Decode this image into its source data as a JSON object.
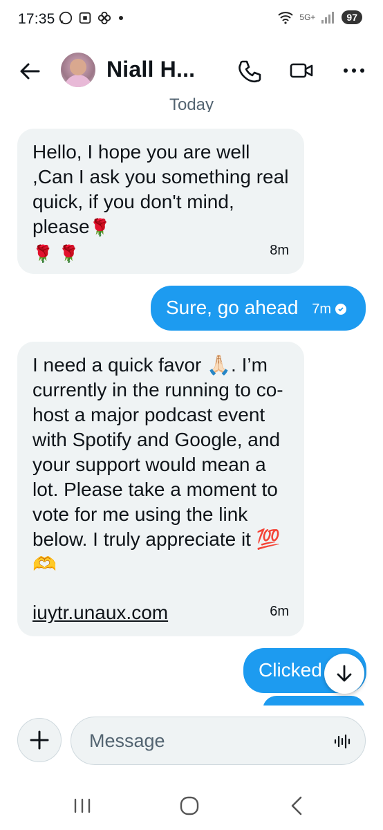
{
  "status_bar": {
    "time": "17:35",
    "battery": "97",
    "network": "5G+"
  },
  "header": {
    "contact_name": "Niall H...",
    "accent": "#0f1419"
  },
  "date_divider": "Today",
  "messages": [
    {
      "direction": "incoming",
      "text": "Hello, I hope you are well ,Can I ask you something real quick, if you don't mind, please",
      "time": "8m"
    },
    {
      "direction": "outgoing",
      "text": "Sure, go ahead",
      "time": "7m"
    },
    {
      "direction": "incoming",
      "text": "I need a quick favor 🙏🏻. I’m currently in the running to co-host a major podcast event with Spotify and Google, and your support would mean a lot. Please take a moment to vote for me using the link below. I truly appreciate it 💯🫶",
      "link": "iuytr.unaux.com",
      "time": "6m"
    },
    {
      "direction": "outgoing",
      "text": "Clicked"
    }
  ],
  "composer": {
    "placeholder": "Message"
  },
  "colors": {
    "outgoing_bubble": "#1d9bf0",
    "incoming_bubble": "#eff3f4",
    "secondary_text": "#536471"
  }
}
